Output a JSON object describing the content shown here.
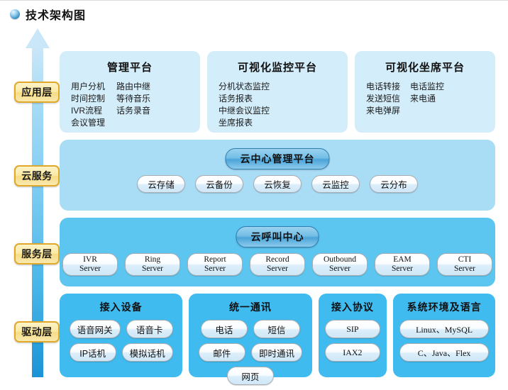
{
  "page": {
    "title": "技术架构图",
    "bullet_icon": "blue-sphere-icon"
  },
  "layers": [
    {
      "badge": "应用层"
    },
    {
      "badge": "云服务"
    },
    {
      "badge": "服务层"
    },
    {
      "badge": "驱动层"
    }
  ],
  "application_layer": {
    "boxes": [
      {
        "title": "管理平台",
        "items": [
          "用户分机",
          "路由中继",
          "时间控制",
          "等待音乐",
          "IVR流程",
          "话务录音",
          "会议管理"
        ]
      },
      {
        "title": "可视化监控平台",
        "items": [
          "分机状态监控",
          "话务报表",
          "中继会议监控",
          "坐席报表"
        ]
      },
      {
        "title": "可视化坐席平台",
        "items": [
          "电话转接",
          "电话监控",
          "发送短信",
          "来电通",
          "来电弹屏"
        ]
      }
    ]
  },
  "cloud_layer": {
    "heading": "云中心管理平台",
    "pills": [
      "云存储",
      "云备份",
      "云恢复",
      "云监控",
      "云分布"
    ]
  },
  "service_layer": {
    "heading": "云呼叫中心",
    "servers": [
      {
        "line1": "IVR",
        "line2": "Server"
      },
      {
        "line1": "Ring",
        "line2": "Server"
      },
      {
        "line1": "Report",
        "line2": "Server"
      },
      {
        "line1": "Record",
        "line2": "Server"
      },
      {
        "line1": "Outbound",
        "line2": "Server"
      },
      {
        "line1": "EAM",
        "line2": "Server"
      },
      {
        "line1": "CTI",
        "line2": "Server"
      }
    ]
  },
  "driver_layer": {
    "boxes": [
      {
        "title": "接入设备",
        "pills": [
          "语音网关",
          "语音卡",
          "IP话机",
          "模拟话机"
        ]
      },
      {
        "title": "统一通讯",
        "pills": [
          "电话",
          "短信",
          "邮件",
          "即时通讯",
          "网页"
        ]
      },
      {
        "title": "接入协议",
        "pills": [
          "SIP",
          "IAX2"
        ]
      },
      {
        "title": "系统环境及语言",
        "pills": [
          "Linux、MySQL",
          "C、Java、Flex"
        ]
      }
    ]
  },
  "colors": {
    "app_box": "#d3edfa",
    "cloud_panel": "#a9dcf5",
    "service_panel": "#5cc6f0",
    "driver_box": "#3fbbef",
    "badge_fill": "#fbe9a2",
    "badge_border": "#e0a92c",
    "arrow_top": "#c9e7f8",
    "arrow_bottom": "#1b93d6"
  }
}
